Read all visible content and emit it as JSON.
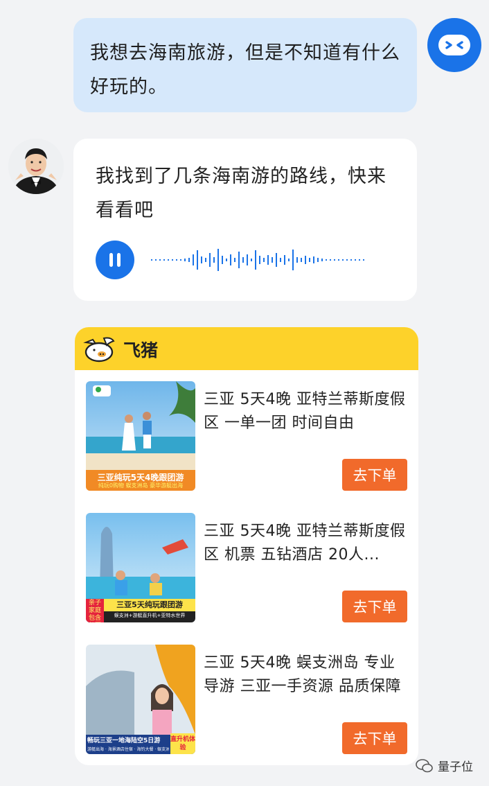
{
  "user_message": {
    "text": "我想去海南旅游，但是不知道有什么好玩的。"
  },
  "agent_reply": {
    "text": "我找到了几条海南游的路线，快来看看吧",
    "audio_state": "playing"
  },
  "card": {
    "brand": "飞猪",
    "brand_color": "#fdd22a",
    "products": [
      {
        "title": "三亚 5天4晚 亚特兰蒂斯度假区 一单一团 时间自由",
        "button": "去下单",
        "thumb_banner": "三亚纯玩5天4晚跟团游",
        "thumb_tag": "纯玩0购物 蜈支洲岛 豪华游艇出海"
      },
      {
        "title": "三亚 5天4晚 亚特兰蒂斯度假区 机票 五钻酒店 20人...",
        "button": "去下单",
        "thumb_side": "亲子家庭 包含机票",
        "thumb_banner": "三亚5天纯玩跟团游",
        "thumb_tag": "蜈支洲+游艇直升机+亚特水世界"
      },
      {
        "title": "三亚 5天4晚 蜈支洲岛 专业导游 三亚一手资源 品质保障",
        "button": "去下单",
        "thumb_banner": "畅玩三亚一地海陆空5日游",
        "thumb_side": "直升机体验",
        "thumb_tag": "游艇出海 · 海景酒店住宿 · 海钓大餐 · 蜈支洲岛"
      }
    ],
    "button_color": "#f16a2b"
  },
  "watermark": {
    "text": "量子位"
  }
}
